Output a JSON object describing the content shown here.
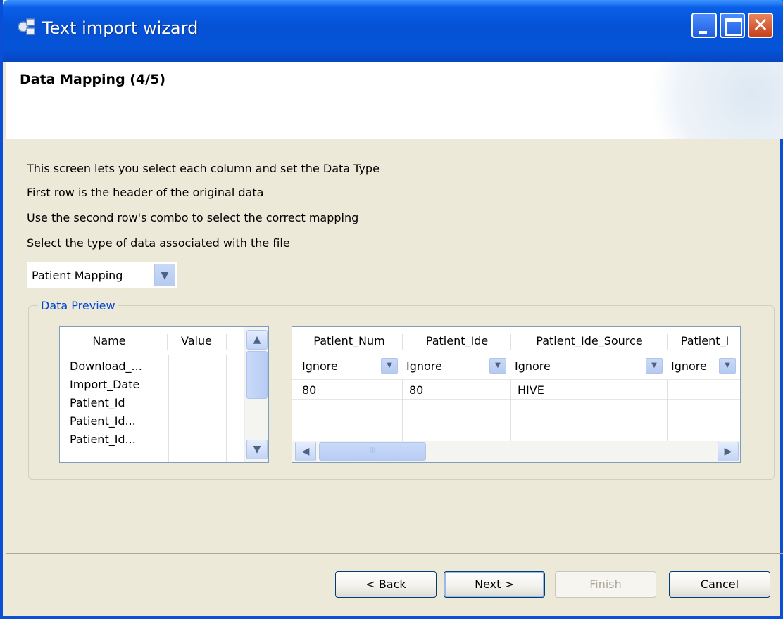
{
  "window": {
    "title": "Text import wizard",
    "controls": {
      "minimize": "minimize",
      "maximize": "maximize",
      "close": "✕"
    }
  },
  "header": {
    "title": "Data Mapping (4/5)"
  },
  "instructions": [
    "This screen lets you select each column and set the Data Type",
    "First row is the header of the original data",
    "Use the second row's combo to select the correct mapping",
    "Select the type of data associated with the file"
  ],
  "type_combo": {
    "value": "Patient Mapping"
  },
  "data_preview": {
    "title": "Data Preview",
    "name_table": {
      "headers": [
        "Name",
        "Value"
      ],
      "rows": [
        "Download_...",
        "Import_Date",
        "Patient_Id",
        "Patient_Id...",
        "Patient_Id..."
      ]
    },
    "mapping_table": {
      "headers": [
        "Patient_Num",
        "Patient_Ide",
        "Patient_Ide_Source",
        "Patient_I"
      ],
      "combo_values": [
        "Ignore",
        "Ignore",
        "Ignore",
        "Ignore"
      ],
      "rows": [
        [
          "80",
          "80",
          "HIVE",
          ""
        ]
      ],
      "scroll_mark": "III"
    }
  },
  "buttons": {
    "back": "< Back",
    "next": "Next >",
    "finish": "Finish",
    "cancel": "Cancel"
  },
  "colors": {
    "titlebar": "#0553d7",
    "accent_text": "#0046d5",
    "dialog_bg": "#ece9d8"
  }
}
